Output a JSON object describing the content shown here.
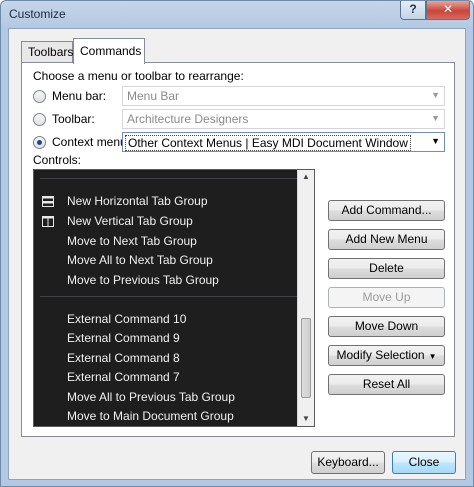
{
  "window": {
    "title": "Customize",
    "help_glyph": "?",
    "close_glyph": "✕"
  },
  "tabs": [
    {
      "label": "Toolbars",
      "selected": false
    },
    {
      "label": "Commands",
      "selected": true
    }
  ],
  "panel": {
    "instruction": "Choose a menu or toolbar to rearrange:",
    "menu_bar": {
      "label": "Menu bar:",
      "value": "Menu Bar",
      "selected": false
    },
    "toolbar": {
      "label": "Toolbar:",
      "value": "Architecture Designers",
      "selected": false
    },
    "context_menu": {
      "label": "Context menu:",
      "value": "Other Context Menus | Easy MDI Document Window",
      "selected": true
    },
    "controls_label": "Controls:"
  },
  "controls": {
    "group1": [
      {
        "label": "New Horizontal Tab Group",
        "icon": "horizontal-tab-group-icon"
      },
      {
        "label": "New Vertical Tab Group",
        "icon": "vertical-tab-group-icon"
      },
      {
        "label": "Move to Next Tab Group",
        "icon": ""
      },
      {
        "label": "Move All to Next Tab Group",
        "icon": ""
      },
      {
        "label": "Move to Previous Tab Group",
        "icon": ""
      }
    ],
    "group2": [
      {
        "label": "External Command 10"
      },
      {
        "label": "External Command 9"
      },
      {
        "label": "External Command 8"
      },
      {
        "label": "External Command 7"
      },
      {
        "label": "Move All to Previous Tab Group"
      },
      {
        "label": "Move to Main Document Group"
      }
    ]
  },
  "buttons": {
    "add_command": "Add Command...",
    "add_new_menu": "Add New Menu",
    "delete": "Delete",
    "move_up": "Move Up",
    "move_down": "Move Down",
    "modify_selection": "Modify Selection",
    "reset_all": "Reset All"
  },
  "footer": {
    "keyboard": "Keyboard...",
    "close": "Close"
  },
  "colors": {
    "list_background": "#1e1e1e",
    "list_text": "#f1f1f1",
    "window_frame": "#b3c8e2"
  }
}
